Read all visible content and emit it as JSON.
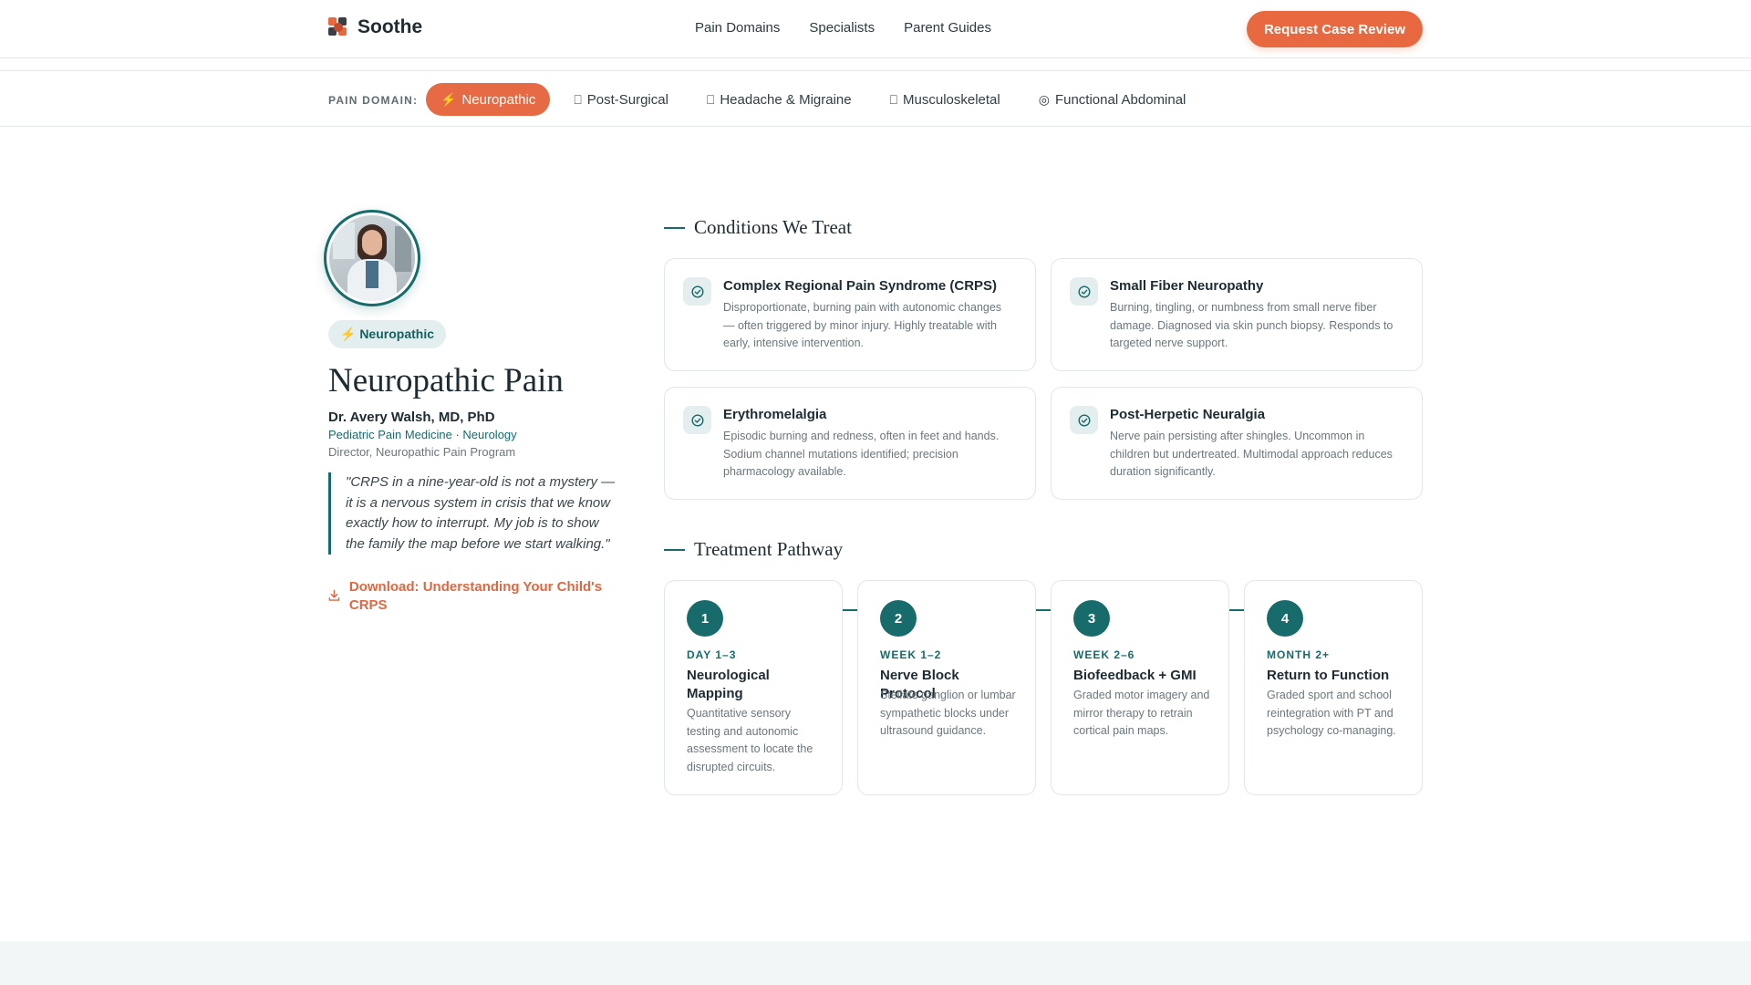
{
  "header": {
    "brand": "Soothe",
    "nav": [
      "Pain Domains",
      "Specialists",
      "Parent Guides"
    ],
    "cta_label": "Request Case Review"
  },
  "domain_bar": {
    "label": "PAIN DOMAIN:",
    "chips": [
      {
        "icon": "⚡",
        "label": "Neuropathic",
        "active": true
      },
      {
        "icon": "⎕",
        "label": "Post-Surgical",
        "active": false
      },
      {
        "icon": "⎕",
        "label": "Headache & Migraine",
        "active": false
      },
      {
        "icon": "⎕",
        "label": "Musculoskeletal",
        "active": false
      },
      {
        "icon": "◎",
        "label": "Functional Abdominal",
        "active": false
      }
    ]
  },
  "profile": {
    "badge": "⚡ Neuropathic",
    "title": "Neuropathic Pain",
    "doctor": "Dr. Avery Walsh, MD, PhD",
    "specialty": "Pediatric Pain Medicine · Neurology",
    "role": "Director, Neuropathic Pain Program",
    "quote": "\"CRPS in a nine-year-old is not a mystery — it is a nervous system in crisis that we know exactly how to interrupt. My job is to show the family the map before we start walking.\"",
    "download": "Download: Understanding Your Child's CRPS"
  },
  "conditions": {
    "heading": "Conditions We Treat",
    "items": [
      {
        "title": "Complex Regional Pain Syndrome (CRPS)",
        "desc": "Disproportionate, burning pain with autonomic changes — often triggered by minor injury. Highly treatable with early, intensive intervention."
      },
      {
        "title": "Small Fiber Neuropathy",
        "desc": "Burning, tingling, or numbness from small nerve fiber damage. Diagnosed via skin punch biopsy. Responds to targeted nerve support."
      },
      {
        "title": "Erythromelalgia",
        "desc": "Episodic burning and redness, often in feet and hands. Sodium channel mutations identified; precision pharmacology available."
      },
      {
        "title": "Post-Herpetic Neuralgia",
        "desc": "Nerve pain persisting after shingles. Uncommon in children but undertreated. Multimodal approach reduces duration significantly."
      }
    ]
  },
  "pathway": {
    "heading": "Treatment Pathway",
    "steps": [
      {
        "num": "1",
        "when": "DAY 1–3",
        "title": "Neurological Mapping",
        "desc": "Quantitative sensory testing and autonomic assessment to locate the disrupted circuits."
      },
      {
        "num": "2",
        "when": "WEEK 1–2",
        "title": "Nerve Block Protocol",
        "desc": "Stellate ganglion or lumbar sympathetic blocks under ultrasound guidance."
      },
      {
        "num": "3",
        "when": "WEEK 2–6",
        "title": "Biofeedback + GMI",
        "desc": "Graded motor imagery and mirror therapy to retrain cortical pain maps."
      },
      {
        "num": "4",
        "when": "MONTH 2+",
        "title": "Return to Function",
        "desc": "Graded sport and school reintegration with PT and psychology co-managing."
      }
    ]
  },
  "colors": {
    "accent": "#e8693f",
    "teal": "#176b6b"
  }
}
